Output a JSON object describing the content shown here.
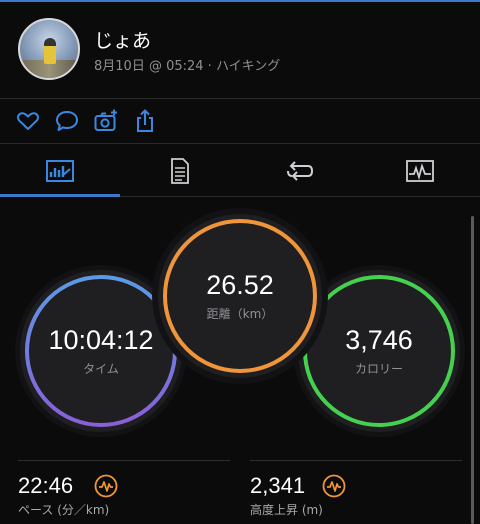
{
  "header": {
    "name": "じょあ",
    "meta": "8月10日 @ 05:24 · ハイキング"
  },
  "actions": [
    "heart-icon",
    "comment-icon",
    "add-photo-icon",
    "share-icon"
  ],
  "tabs": [
    {
      "icon": "stats-chart-icon",
      "active": true
    },
    {
      "icon": "notes-icon",
      "active": false
    },
    {
      "icon": "laps-icon",
      "active": false
    },
    {
      "icon": "graph-icon",
      "active": false
    }
  ],
  "rings": {
    "time": {
      "value": "10:04:12",
      "label": "タイム"
    },
    "distance": {
      "value": "26.52",
      "label": "距離（km）"
    },
    "calories": {
      "value": "3,746",
      "label": "カロリー"
    }
  },
  "stats": {
    "pace": {
      "value": "22:46",
      "label": "ペース (分／km)"
    },
    "elevation": {
      "value": "2,341",
      "label": "高度上昇 (m)"
    }
  },
  "colors": {
    "accent": "#3b78c8",
    "distance_ring": "#f0953a",
    "calories_ring": "#45d14f",
    "time_ring_top": "#5b9ae6",
    "time_ring_bottom": "#8a5fd8",
    "chart_badge": "#f0953a"
  }
}
